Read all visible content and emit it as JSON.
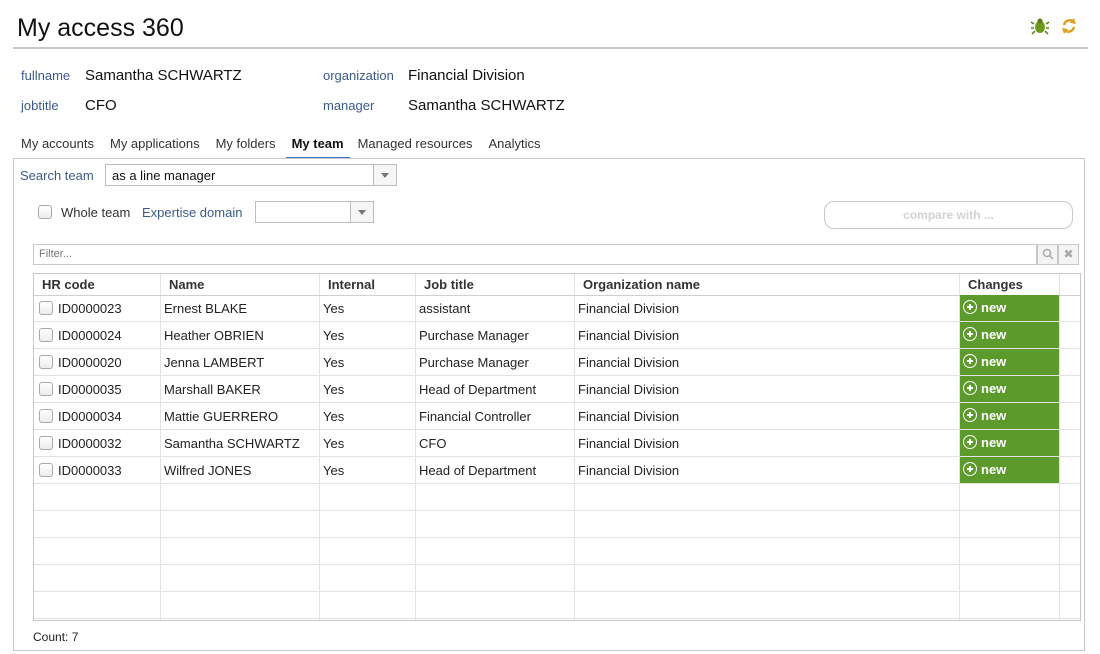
{
  "app": {
    "title": "My access 360"
  },
  "identity": {
    "fullname_label": "fullname",
    "fullname": "Samantha SCHWARTZ",
    "jobtitle_label": "jobtitle",
    "jobtitle": "CFO",
    "organization_label": "organization",
    "organization": "Financial Division",
    "manager_label": "manager",
    "manager": "Samantha SCHWARTZ"
  },
  "tabs": [
    "My accounts",
    "My applications",
    "My folders",
    "My team",
    "Managed resources",
    "Analytics"
  ],
  "active_tab": "My team",
  "search": {
    "label": "Search team",
    "value": "as a line manager",
    "whole_team_label": "Whole team",
    "expertise_label": "Expertise domain",
    "expertise_value": "",
    "compare_label": "compare with ...",
    "filter_placeholder": "Filter..."
  },
  "table": {
    "columns": [
      "HR code",
      "Name",
      "Internal",
      "Job title",
      "Organization name",
      "Changes"
    ],
    "rows": [
      {
        "hr_code": "ID0000023",
        "name": "Ernest BLAKE",
        "internal": "Yes",
        "job_title": "assistant",
        "org": "Financial Division",
        "change": "new"
      },
      {
        "hr_code": "ID0000024",
        "name": "Heather OBRIEN",
        "internal": "Yes",
        "job_title": "Purchase Manager",
        "org": "Financial Division",
        "change": "new"
      },
      {
        "hr_code": "ID0000020",
        "name": "Jenna LAMBERT",
        "internal": "Yes",
        "job_title": "Purchase Manager",
        "org": "Financial Division",
        "change": "new"
      },
      {
        "hr_code": "ID0000035",
        "name": "Marshall BAKER",
        "internal": "Yes",
        "job_title": "Head of Department",
        "org": "Financial Division",
        "change": "new"
      },
      {
        "hr_code": "ID0000034",
        "name": "Mattie GUERRERO",
        "internal": "Yes",
        "job_title": "Financial Controller",
        "org": "Financial Division",
        "change": "new"
      },
      {
        "hr_code": "ID0000032",
        "name": "Samantha SCHWARTZ",
        "internal": "Yes",
        "job_title": "CFO",
        "org": "Financial Division",
        "change": "new"
      },
      {
        "hr_code": "ID0000033",
        "name": "Wilfred JONES",
        "internal": "Yes",
        "job_title": "Head of Department",
        "org": "Financial Division",
        "change": "new"
      }
    ]
  },
  "footer": {
    "count": "Count: 7"
  },
  "icons": {
    "bug": "bug-icon",
    "refresh": "refresh-icon",
    "search": "search-icon",
    "clear": "clear-icon",
    "add": "plus-circle-icon"
  },
  "colors": {
    "accent": "#3c78c8",
    "change_bg": "#5c9a2c",
    "label": "#3a5a8c"
  }
}
